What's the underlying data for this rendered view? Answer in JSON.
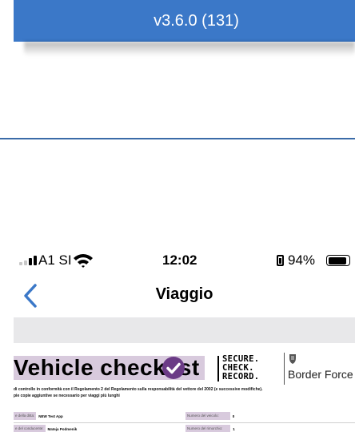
{
  "app": {
    "version_label": "v3.6.0 (131)",
    "accent_color": "#3b78c8"
  },
  "status_bar": {
    "carrier": "A1 SI",
    "time": "12:02",
    "battery_percent": "94%",
    "signal_bars_active": 2,
    "signal_bars_total": 4
  },
  "nav": {
    "title": "Viaggio",
    "back_icon": "chevron-left-icon"
  },
  "document": {
    "title": "Vehicle checklist",
    "title_icon": "check-circle-icon",
    "logo_secure_lines": [
      "SECURE.",
      "CHECK.",
      "RECORD."
    ],
    "logo_border_force": "Border Force",
    "regulation_lines": [
      "di controllo in conformità con il Regolamento 2 del Regolamento sulla responsabilità del vettore del 2002 (e successive modifiche).",
      "pie copie aggiuntive se necessario per viaggi più lunghi"
    ],
    "fields": [
      {
        "label": "e della ditta:",
        "value": "NEW Test App"
      },
      {
        "label": "Numero del veicolo:",
        "value": "0"
      },
      {
        "label": "e del conducente:",
        "value": "Mateja Podmenik"
      },
      {
        "label": "Numero del rimorchio:",
        "value": "1"
      }
    ]
  }
}
